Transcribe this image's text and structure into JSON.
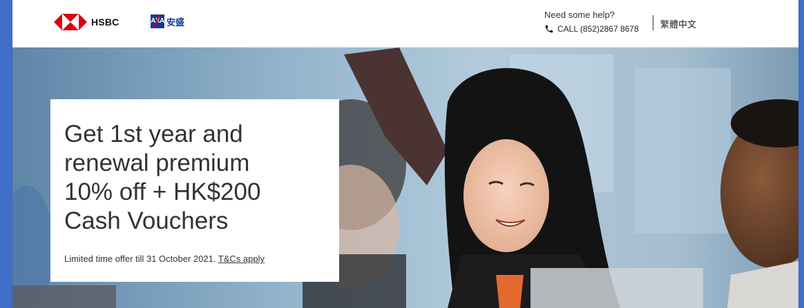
{
  "header": {
    "hsbc_label": "HSBC",
    "axa_mark": "AXA",
    "axa_cn": "安盛",
    "help_title": "Need some help?",
    "call_label": "CALL (852)2867 8678",
    "language": "繁體中文"
  },
  "hero": {
    "title": "Get 1st year and\nrenewal premium\n10% off + HK$200\nCash Vouchers",
    "note_prefix": "Limited time offer till 31 October 2021. ",
    "tcs_link": "T&Cs apply"
  },
  "colors": {
    "hsbc_red": "#db0011",
    "axa_blue": "#123a8a",
    "axa_red": "#d4002a",
    "page_border": "#3f6fc9"
  },
  "icons": [
    "hsbc-hexagon-icon",
    "axa-logo-icon",
    "phone-icon"
  ]
}
